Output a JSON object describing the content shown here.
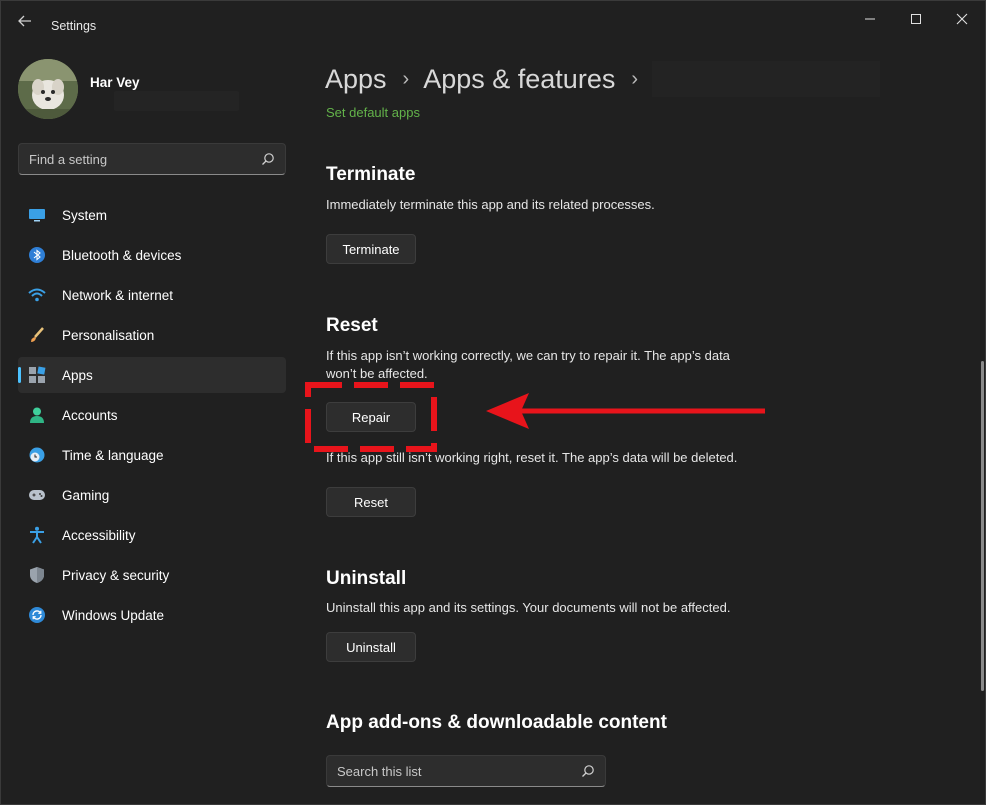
{
  "window": {
    "title": "Settings",
    "controls": [
      "minimize",
      "maximize",
      "close"
    ]
  },
  "profile": {
    "name": "Har Vey"
  },
  "sidebar": {
    "search_placeholder": "Find a setting",
    "items": [
      {
        "label": "System",
        "icon": "monitor-icon"
      },
      {
        "label": "Bluetooth & devices",
        "icon": "bluetooth-icon"
      },
      {
        "label": "Network & internet",
        "icon": "wifi-icon"
      },
      {
        "label": "Personalisation",
        "icon": "brush-icon"
      },
      {
        "label": "Apps",
        "icon": "apps-icon",
        "active": true
      },
      {
        "label": "Accounts",
        "icon": "person-icon"
      },
      {
        "label": "Time & language",
        "icon": "globe-clock-icon"
      },
      {
        "label": "Gaming",
        "icon": "gamepad-icon"
      },
      {
        "label": "Accessibility",
        "icon": "accessibility-icon"
      },
      {
        "label": "Privacy & security",
        "icon": "shield-icon"
      },
      {
        "label": "Windows Update",
        "icon": "update-icon"
      }
    ]
  },
  "breadcrumb": {
    "items": [
      "Apps",
      "Apps & features"
    ]
  },
  "main": {
    "default_apps_link": "Set default apps",
    "terminate": {
      "title": "Terminate",
      "description": "Immediately terminate this app and its related processes.",
      "button": "Terminate"
    },
    "reset": {
      "title": "Reset",
      "repair_description_line1": "If this app isn’t working correctly, we can try to repair it. The app’s data",
      "repair_description_line2": "won’t be affected.",
      "repair_button": "Repair",
      "reset_description": "If this app still isn’t working right, reset it. The app’s data will be deleted.",
      "reset_button": "Reset"
    },
    "uninstall": {
      "title": "Uninstall",
      "description": "Uninstall this app and its settings. Your documents will not be affected.",
      "button": "Uninstall"
    },
    "addons": {
      "title": "App add-ons & downloadable content",
      "search_placeholder": "Search this list"
    }
  },
  "colors": {
    "background": "#202020",
    "accent": "#4cc2ff",
    "link": "#63b34a",
    "annotation": "#e8141b"
  }
}
